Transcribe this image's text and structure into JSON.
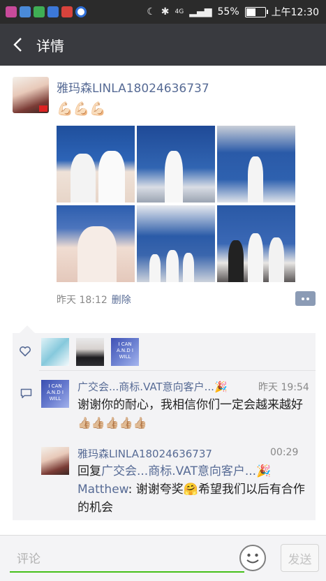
{
  "status_bar": {
    "battery": "55%",
    "time": "上午12:30",
    "network": "4G",
    "icons": [
      "moon-icon",
      "bluetooth-icon",
      "signal-icon",
      "battery-icon"
    ],
    "battery_level": 0.55
  },
  "header": {
    "title": "详情",
    "back_icon": "chevron-left-icon"
  },
  "post": {
    "author": "雅玛森LINLA18024636737",
    "text": "💪🏻💪🏻💪🏻",
    "time": "昨天 18:12",
    "delete_label": "删除",
    "photos_count_shown": 6
  },
  "likes": {
    "icon": "heart-icon",
    "avatar_labels": [
      "",
      "",
      "I CAN A.N.D I WILL"
    ]
  },
  "comments": [
    {
      "author": "广交会...商标.VAT意向客户...🎉",
      "time": "昨天 19:54",
      "text": "谢谢你的耐心，我相信你们一定会越来越好",
      "thumbs": "👍🏼👍🏼👍🏼👍🏼👍🏼",
      "avatar_label": "I CAN A.N.D I WILL"
    },
    {
      "author": "雅玛森LINLA18024636737",
      "time": "00:29",
      "reply_prefix": "回复",
      "reply_to": "广交会...商标.VAT意向客户...🎉",
      "colon": "：",
      "mention": "Matthew",
      "text_a": ": 谢谢夸奖",
      "emoji": "🤗",
      "text_b": "希望我们以后有合作的机会"
    }
  ],
  "input": {
    "placeholder": "评论",
    "send_label": "发送",
    "emoji_icon": "emoji-face-icon"
  },
  "colors": {
    "link": "#576b95",
    "header_bg": "#393a3f",
    "accent_green": "#45c01a"
  }
}
